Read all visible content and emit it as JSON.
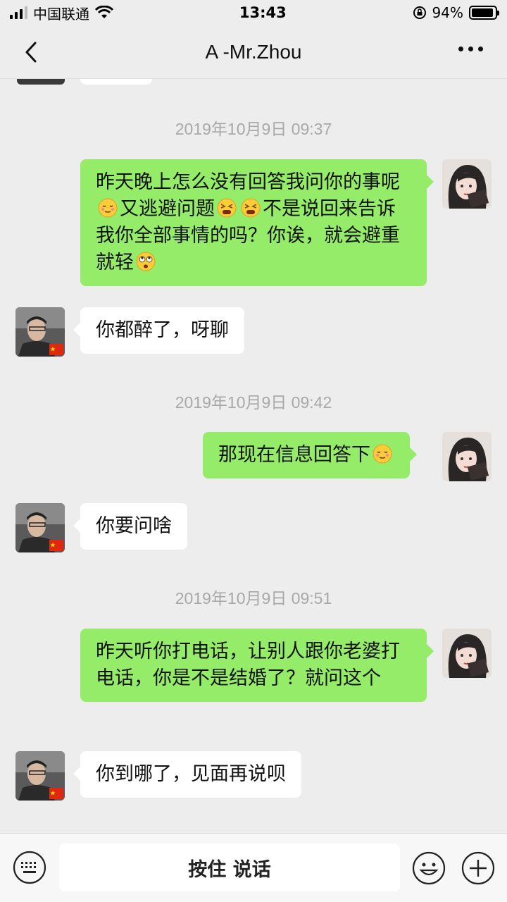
{
  "status_bar": {
    "carrier": "中国联通",
    "time": "13:43",
    "battery_text": "94%",
    "battery_level": 0.94,
    "icons": [
      "signal-icon",
      "wifi-icon",
      "rotation-lock-icon",
      "battery-icon"
    ]
  },
  "nav": {
    "title": "A -Mr.Zhou",
    "back_icon": "chevron-left-icon",
    "more_icon": "more-dots-icon"
  },
  "messages": [
    {
      "type": "timestamp",
      "text": "2019年10月9日 09:37"
    },
    {
      "type": "sent",
      "parts": [
        "昨天晚上怎么没有回答我问你的事呢",
        "[emoji:relieved]",
        "又逃避问题",
        "[emoji:tired]",
        "[emoji:tired]",
        "不是说回来告诉我你全部事情的吗？你诶，就会避重就轻",
        "[emoji:rolling-eyes]"
      ]
    },
    {
      "type": "received",
      "text": "你都醉了，呀聊"
    },
    {
      "type": "timestamp",
      "text": "2019年10月9日 09:42"
    },
    {
      "type": "sent",
      "parts": [
        "那现在信息回答下",
        "[emoji:relieved]"
      ]
    },
    {
      "type": "received",
      "text": "你要问啥"
    },
    {
      "type": "timestamp",
      "text": "2019年10月9日 09:51"
    },
    {
      "type": "sent",
      "text": "昨天听你打电话，让别人跟你老婆打电话，你是不是结婚了？就问这个"
    },
    {
      "type": "received",
      "text": "你到哪了，见面再说呗"
    }
  ],
  "msg_text": {
    "m1_a": "昨天晚上怎么没有回答我问你的事呢",
    "m1_b": "又逃避问题",
    "m1_c": "不是说回来告诉我你全部事情的吗？你诶，就会避重就轻",
    "m2": "你都醉了，呀聊",
    "m3": "那现在信息回答下",
    "m4": "你要问啥",
    "m5": "昨天听你打电话，让别人跟你老婆打电话，你是不是结婚了？就问这个",
    "m6": "你到哪了，见面再说呗"
  },
  "timestamps": {
    "t1": "2019年10月9日 09:37",
    "t2": "2019年10月9日 09:42",
    "t3": "2019年10月9日 09:51"
  },
  "input_bar": {
    "hold_to_talk": "按住 说话",
    "keyboard_icon": "keyboard-icon",
    "emoji_icon": "emoji-face-icon",
    "plus_icon": "plus-circle-icon"
  },
  "colors": {
    "sent_bubble": "#95ec69",
    "received_bubble": "#ffffff",
    "background": "#ededed"
  }
}
